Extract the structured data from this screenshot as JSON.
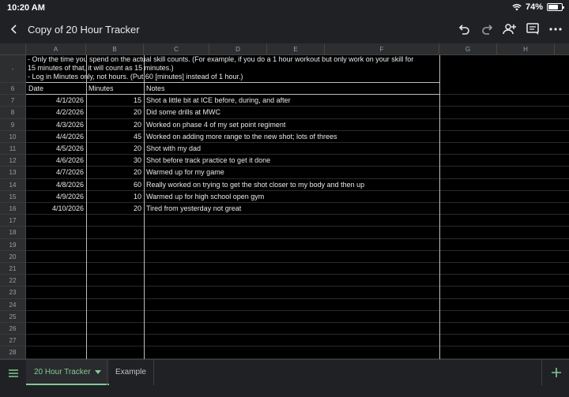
{
  "status": {
    "time": "10:20 AM",
    "battery": "74%",
    "battery_level": 0.74
  },
  "appbar": {
    "title": "Copy of 20 Hour Tracker"
  },
  "columns": [
    "A",
    "B",
    "C",
    "D",
    "E",
    "F",
    "G",
    "H"
  ],
  "notes": {
    "line1": "- Only the time you spend on the actual skill counts. (For example, if you do a 1 hour workout but only work on your skill for",
    "line2": "15 minutes of that, it will count as 15 minutes.)",
    "line3": "- Log in Minutes only, not hours. (Put 60 [minutes] instead of 1 hour.)"
  },
  "table": {
    "headers": {
      "date": "Date",
      "minutes": "Minutes",
      "notes": "Notes"
    },
    "rows": [
      {
        "date": "4/1/2026",
        "minutes": "15",
        "notes": "Shot a little bit at ICE before, during, and after"
      },
      {
        "date": "4/2/2026",
        "minutes": "20",
        "notes": "Did some drills at MWC"
      },
      {
        "date": "4/3/2026",
        "minutes": "20",
        "notes": "Worked on phase 4 of my set point regiment"
      },
      {
        "date": "4/4/2026",
        "minutes": "45",
        "notes": "Worked on adding more range to the new shot; lots of threes"
      },
      {
        "date": "4/5/2026",
        "minutes": "20",
        "notes": "Shot with my dad"
      },
      {
        "date": "4/6/2026",
        "minutes": "30",
        "notes": "Shot before track practice to get it done"
      },
      {
        "date": "4/7/2026",
        "minutes": "20",
        "notes": "Warmed up for my game"
      },
      {
        "date": "4/8/2026",
        "minutes": "60",
        "notes": "Really worked on trying to get the shot closer to my body and then up"
      },
      {
        "date": "4/9/2026",
        "minutes": "10",
        "notes": "Warmed up for high school open gym"
      },
      {
        "date": "4/10/2026",
        "minutes": "20",
        "notes": "Tired from yesterday not great"
      }
    ]
  },
  "row_numbers": [
    "6",
    "7",
    "8",
    "9",
    "10",
    "11",
    "12",
    "13",
    "14",
    "15",
    "16",
    "17",
    "18",
    "19",
    "20",
    "21",
    "22",
    "23",
    "24",
    "25",
    "26",
    "27",
    "28"
  ],
  "frozen_row_marker": "-",
  "tabs": {
    "active": "20 Hour Tracker",
    "inactive": "Example"
  }
}
